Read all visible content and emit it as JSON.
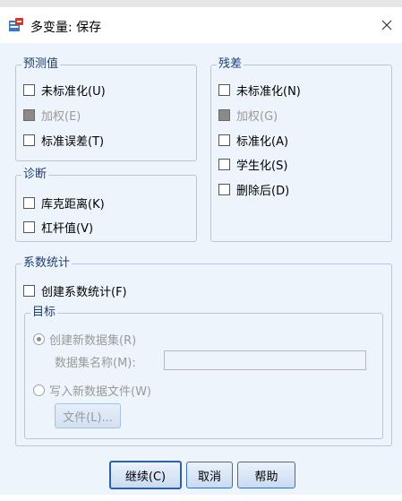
{
  "window": {
    "title": "多变量: 保存"
  },
  "predicted": {
    "legend": "预测值",
    "items": [
      {
        "label": "未标准化(U)",
        "disabled": false
      },
      {
        "label": "加权(E)",
        "disabled": true
      },
      {
        "label": "标准误差(T)",
        "disabled": false
      }
    ]
  },
  "diagnostics": {
    "legend": "诊断",
    "items": [
      {
        "label": "库克距离(K)"
      },
      {
        "label": "杠杆值(V)"
      }
    ]
  },
  "residuals": {
    "legend": "残差",
    "items": [
      {
        "label": "未标准化(N)",
        "disabled": false
      },
      {
        "label": "加权(G)",
        "disabled": true
      },
      {
        "label": "标准化(A)",
        "disabled": false
      },
      {
        "label": "学生化(S)",
        "disabled": false
      },
      {
        "label": "删除后(D)",
        "disabled": false
      }
    ]
  },
  "coef_stats": {
    "legend": "系数统计",
    "create_label": "创建系数统计(F)",
    "target": {
      "legend": "目标",
      "new_dataset_label": "创建新数据集(R)",
      "dataset_name_label": "数据集名称(M):",
      "dataset_name_value": "",
      "write_file_label": "写入新数据文件(W)",
      "file_button": "文件(L)..."
    }
  },
  "buttons": {
    "continue": "继续(C)",
    "cancel": "取消",
    "help": "帮助"
  }
}
